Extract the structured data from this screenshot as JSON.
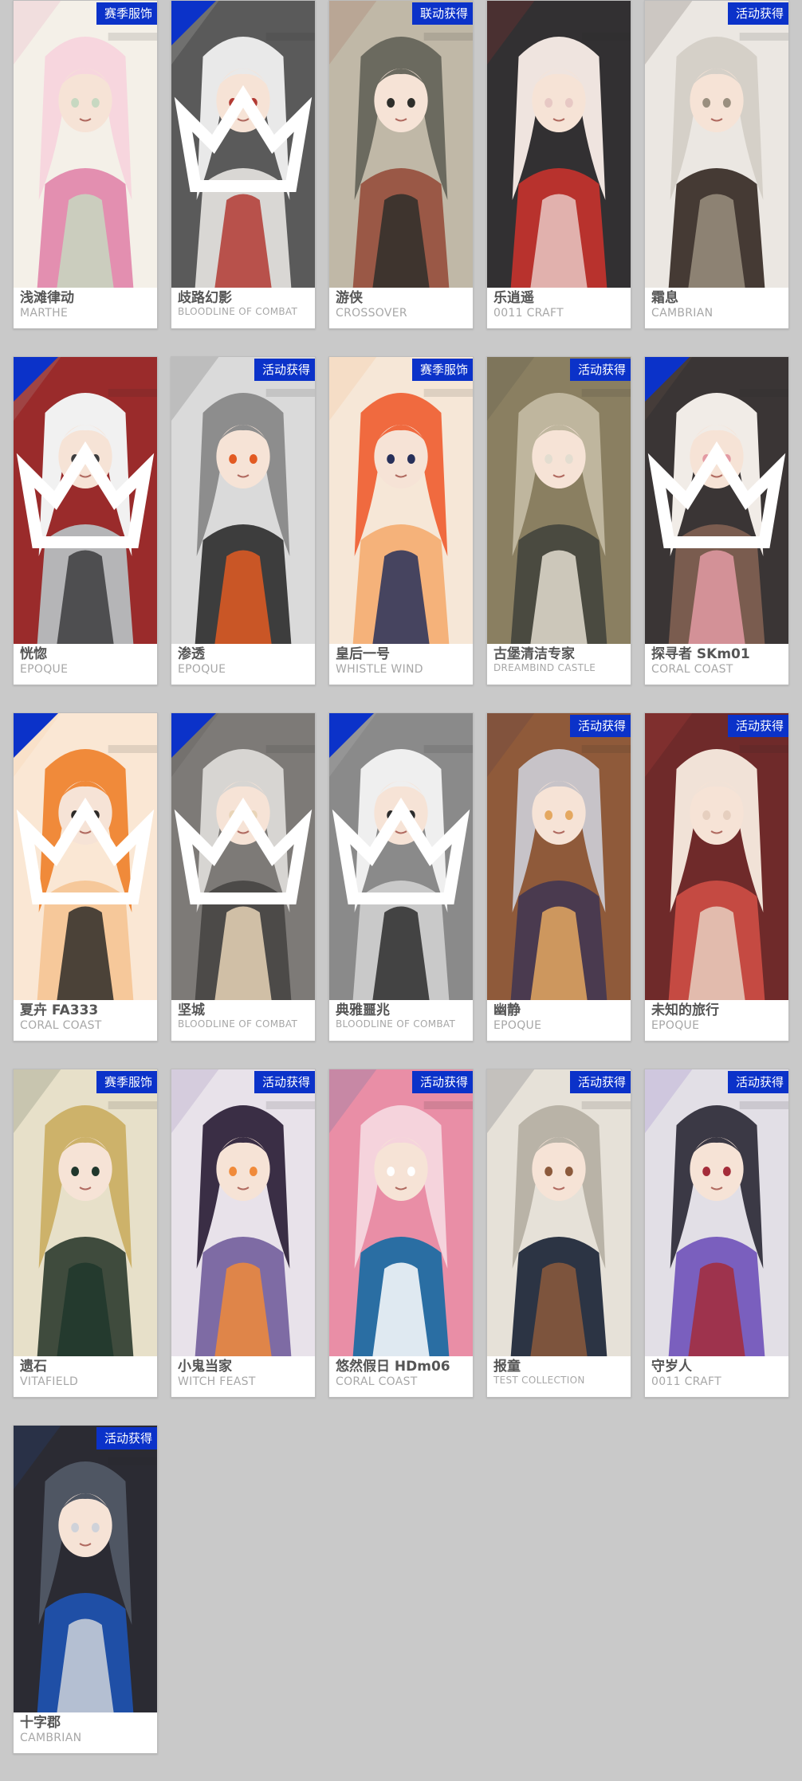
{
  "skins": [
    {
      "name": "浅滩律动",
      "series": "MARTHE",
      "badge": "赛季服饰",
      "palette": [
        "#f7d6de",
        "#e38fb0",
        "#c7d8c1",
        "#f4f0e8"
      ]
    },
    {
      "name": "歧路幻影",
      "series": "BLOODLINE OF COMBAT",
      "badge": "",
      "corner": true,
      "palette": [
        "#e9e9e9",
        "#d9d7d4",
        "#b23a33",
        "#5a5a5a"
      ]
    },
    {
      "name": "游侠",
      "series": "CROSSOVER",
      "badge": "联动获得",
      "palette": [
        "#6b6a5f",
        "#9a5846",
        "#2e2e2a",
        "#c0b8a7"
      ]
    },
    {
      "name": "乐逍遥",
      "series": "0011 CRAFT",
      "badge": "",
      "palette": [
        "#efe4df",
        "#b8322d",
        "#e7c8c4",
        "#323032"
      ]
    },
    {
      "name": "霜息",
      "series": "CAMBRIAN",
      "badge": "活动获得",
      "palette": [
        "#d5d0c8",
        "#453a34",
        "#9a8f7f",
        "#ebe7e2"
      ]
    },
    {
      "name": "恍惚",
      "series": "EPOQUE",
      "badge": "",
      "corner": true,
      "palette": [
        "#f1f1f1",
        "#b5b5b7",
        "#3c3c3e",
        "#9a2b2b"
      ]
    },
    {
      "name": "渗透",
      "series": "EPOQUE",
      "badge": "活动获得",
      "palette": [
        "#8d8d8d",
        "#3d3d3d",
        "#e25a22",
        "#dadada"
      ]
    },
    {
      "name": "皇后一号",
      "series": "WHISTLE WIND",
      "badge": "赛季服饰",
      "palette": [
        "#f06a3f",
        "#f5b27a",
        "#27305a",
        "#f6e7d7"
      ]
    },
    {
      "name": "古堡清洁专家",
      "series": "DREAMBIND CASTLE",
      "badge": "活动获得",
      "palette": [
        "#bfb69e",
        "#4a4a40",
        "#e3ddd0",
        "#8a7f61"
      ]
    },
    {
      "name": "探寻者 SKm01",
      "series": "CORAL COAST",
      "badge": "",
      "corner": true,
      "palette": [
        "#f1ece7",
        "#7a5c4f",
        "#e39aa3",
        "#3a3535"
      ]
    },
    {
      "name": "夏卉 FA333",
      "series": "CORAL COAST",
      "badge": "",
      "corner": true,
      "palette": [
        "#f08a3a",
        "#f6c89a",
        "#2d2a27",
        "#fae7d4"
      ]
    },
    {
      "name": "坚城",
      "series": "BLOODLINE OF COMBAT",
      "badge": "",
      "corner": true,
      "palette": [
        "#d7d5d2",
        "#4c4a48",
        "#e8d4b7",
        "#7d7a77"
      ]
    },
    {
      "name": "典雅噩兆",
      "series": "BLOODLINE OF COMBAT",
      "badge": "",
      "corner": true,
      "palette": [
        "#efefef",
        "#c9c9c9",
        "#2b2b2b",
        "#8a8a8a"
      ]
    },
    {
      "name": "幽静",
      "series": "EPOQUE",
      "badge": "活动获得",
      "palette": [
        "#c7c3c8",
        "#4a3a4f",
        "#e4a860",
        "#8f5a3a"
      ]
    },
    {
      "name": "未知的旅行",
      "series": "EPOQUE",
      "badge": "活动获得",
      "palette": [
        "#f1e2d7",
        "#c54a42",
        "#e6cfbf",
        "#6f2a2a"
      ]
    },
    {
      "name": "遗石",
      "series": "VITAFIELD",
      "badge": "赛季服饰",
      "palette": [
        "#cdb26a",
        "#3f4b3d",
        "#20372c",
        "#e7e0c9"
      ]
    },
    {
      "name": "小鬼当家",
      "series": "WITCH FEAST",
      "badge": "活动获得",
      "palette": [
        "#3a2e45",
        "#7e6ba4",
        "#f08a3a",
        "#e8e2ea"
      ]
    },
    {
      "name": "悠然假日 HDm06",
      "series": "CORAL COAST",
      "badge": "活动获得",
      "palette": [
        "#f5d3dc",
        "#2a6ea3",
        "#ffffff",
        "#e98ea6"
      ]
    },
    {
      "name": "报童",
      "series": "TEST COLLECTION",
      "badge": "活动获得",
      "palette": [
        "#b9b3a7",
        "#2c3444",
        "#8c5a3c",
        "#e6e1d8"
      ]
    },
    {
      "name": "守岁人",
      "series": "0011 CRAFT",
      "badge": "活动获得",
      "palette": [
        "#3b3945",
        "#7a5fbe",
        "#a42c3a",
        "#e2dfe6"
      ]
    },
    {
      "name": "十字郡",
      "series": "CAMBRIAN",
      "badge": "活动获得",
      "palette": [
        "#4f5663",
        "#1f4fa6",
        "#cfd2d9",
        "#2b2b33"
      ]
    }
  ]
}
